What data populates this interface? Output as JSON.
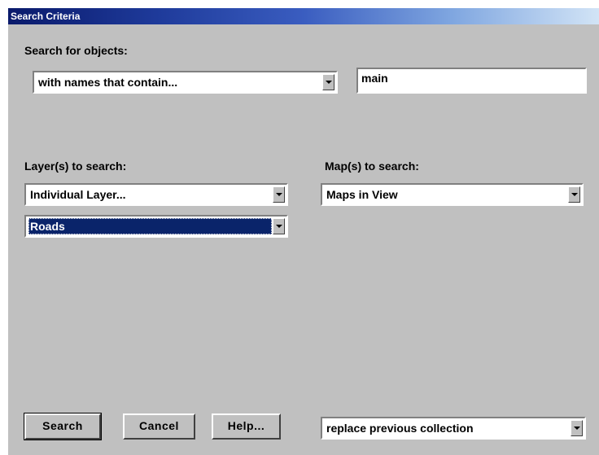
{
  "window": {
    "title": "Search Criteria"
  },
  "search_for": {
    "label": "Search for objects:",
    "mode": "with names that contain...",
    "query": "main"
  },
  "layers": {
    "label": "Layer(s) to search:",
    "scope": "Individual Layer...",
    "layer": "Roads"
  },
  "maps": {
    "label": "Map(s) to search:",
    "scope": "Maps in View"
  },
  "buttons": {
    "search": "Search",
    "cancel": "Cancel",
    "help": "Help..."
  },
  "collection": {
    "mode": "replace previous collection"
  },
  "colors": {
    "window_bg": "#c0c0c0",
    "selection": "#0a246a",
    "title_start": "#0a1a6b",
    "title_end": "#d2e4f6"
  }
}
